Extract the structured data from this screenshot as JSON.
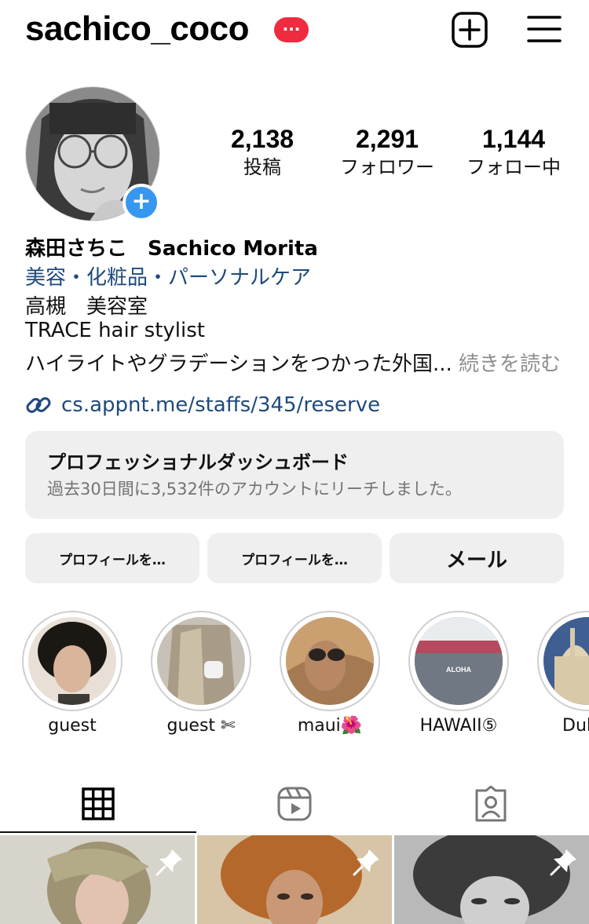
{
  "header": {
    "username": "sachico_coco",
    "badge": "···",
    "icons": [
      "new-post-icon",
      "menu-icon"
    ]
  },
  "stats": [
    {
      "value": "2,138",
      "label": "投稿"
    },
    {
      "value": "2,291",
      "label": "フォロワー"
    },
    {
      "value": "1,144",
      "label": "フォロー中"
    }
  ],
  "bio": {
    "full_name": "森田さちこ　Sachico Morita",
    "category": "美容・化粧品・パーソナルケア",
    "line1": "高槻　美容室",
    "line2": "TRACE hair stylist",
    "line3": "ハイライトやグラデーションをつかった外国...",
    "more": "続きを読む",
    "link": "cs.appnt.me/staffs/345/reserve"
  },
  "dashboard": {
    "title": "プロフェッショナルダッシュボード",
    "subtitle": "過去30日間に3,532件のアカウントにリーチしました。"
  },
  "buttons": {
    "edit_profile": "プロフィールを…",
    "share_profile": "プロフィールを…",
    "email": "メール"
  },
  "highlights": [
    {
      "label": "guest"
    },
    {
      "label": "guest ✄"
    },
    {
      "label": "maui🌺"
    },
    {
      "label": "HAWAII⑤",
      "photo_text": "ALOHA"
    },
    {
      "label": "Dul"
    }
  ],
  "tabs": [
    "grid-icon",
    "reels-icon",
    "tagged-icon"
  ],
  "colors": {
    "accent_blue": "#3797f0",
    "link_blue": "#1e4a7d",
    "badge_red": "#ef2b3f",
    "button_bg": "#efefef"
  }
}
